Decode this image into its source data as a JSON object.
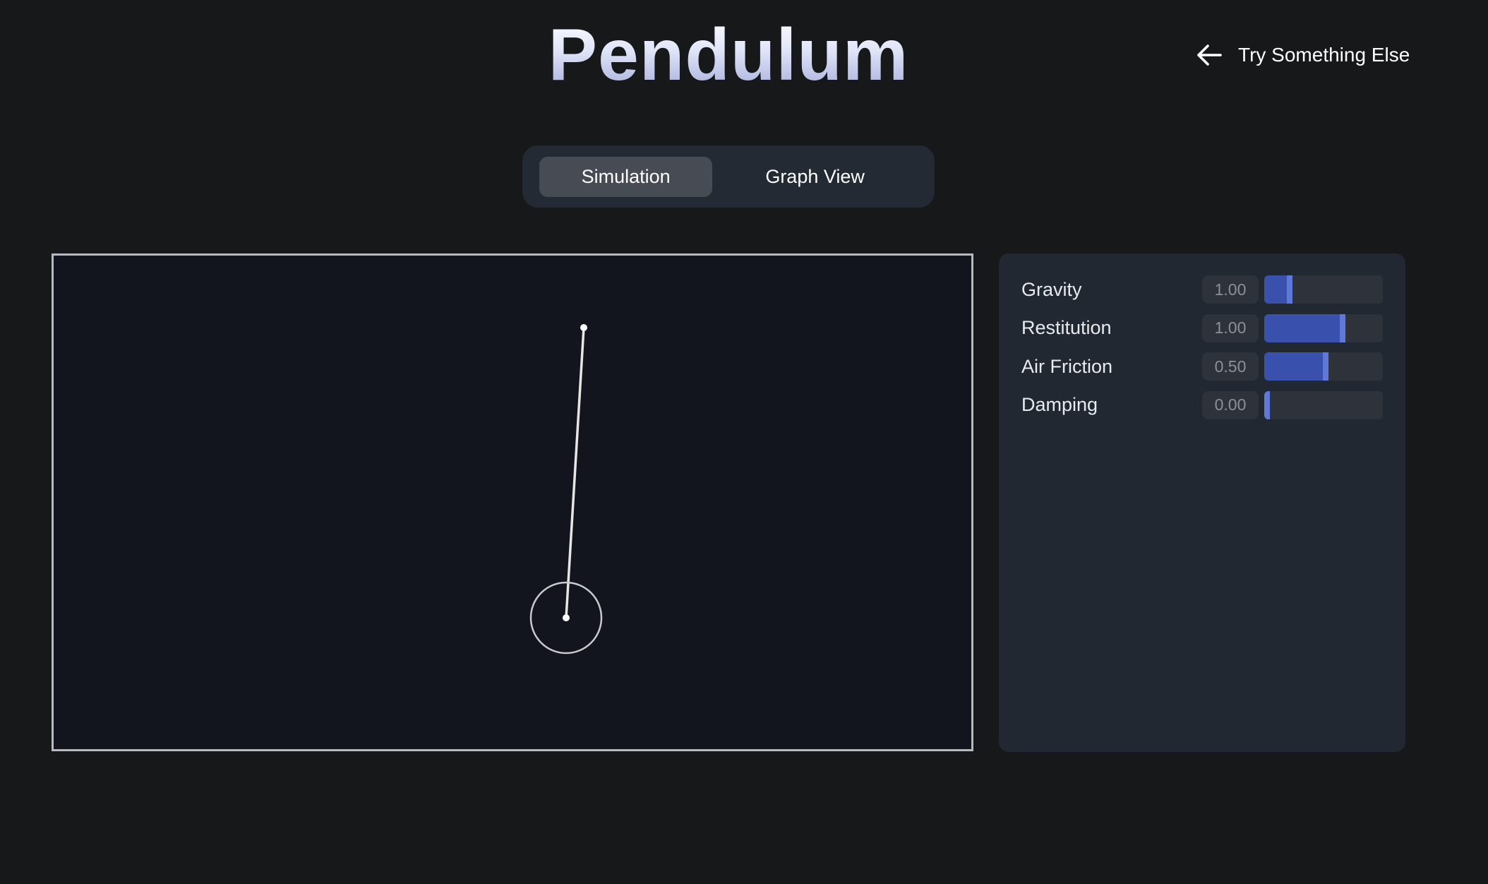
{
  "header": {
    "title": "Pendulum",
    "back_link_label": "Try Something Else"
  },
  "tabs": [
    {
      "label": "Simulation",
      "active": true
    },
    {
      "label": "Graph View",
      "active": false
    }
  ],
  "controls": [
    {
      "label": "Gravity",
      "value": "1.00",
      "fill_fraction": 0.2
    },
    {
      "label": "Restitution",
      "value": "1.00",
      "fill_fraction": 0.67
    },
    {
      "label": "Air Friction",
      "value": "0.50",
      "fill_fraction": 0.52
    },
    {
      "label": "Damping",
      "value": "0.00",
      "fill_fraction": 0.0
    }
  ],
  "colors": {
    "background": "#17181a",
    "canvas_background": "#13151e",
    "panel_background": "#222831",
    "slider_fill": "#3a50ad",
    "slider_thumb": "#5f79db"
  },
  "icons": {
    "back": "arrow-left-icon"
  }
}
